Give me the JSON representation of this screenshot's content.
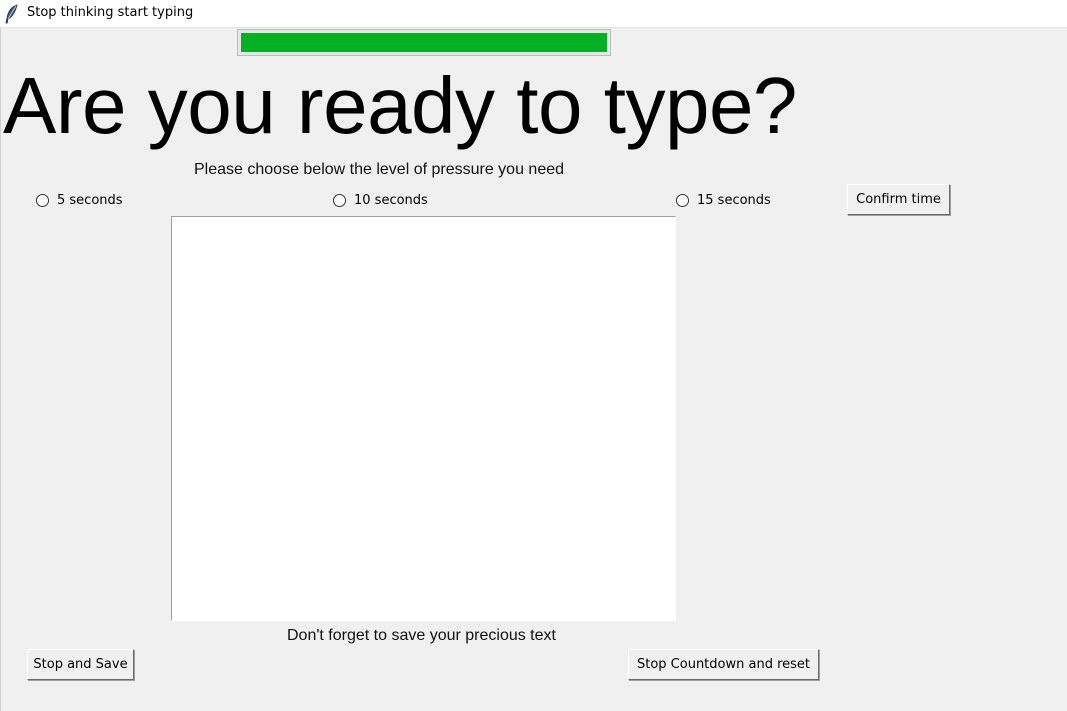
{
  "window": {
    "title": "Stop thinking start typing",
    "icon": "feather-icon"
  },
  "progress": {
    "value_percent": 100,
    "color": "#06b025"
  },
  "main": {
    "heading": "Are you ready to type?",
    "instruction": "Please choose below the level of pressure you need",
    "radio_options": [
      {
        "label": "5 seconds",
        "selected": false
      },
      {
        "label": "10 seconds",
        "selected": false
      },
      {
        "label": "15 seconds",
        "selected": false
      }
    ],
    "confirm_label": "Confirm time",
    "text_value": "",
    "footer_note": "Don't forget to save your precious text"
  },
  "actions": {
    "stop_save_label": "Stop and Save",
    "stop_reset_label": "Stop Countdown and reset"
  }
}
